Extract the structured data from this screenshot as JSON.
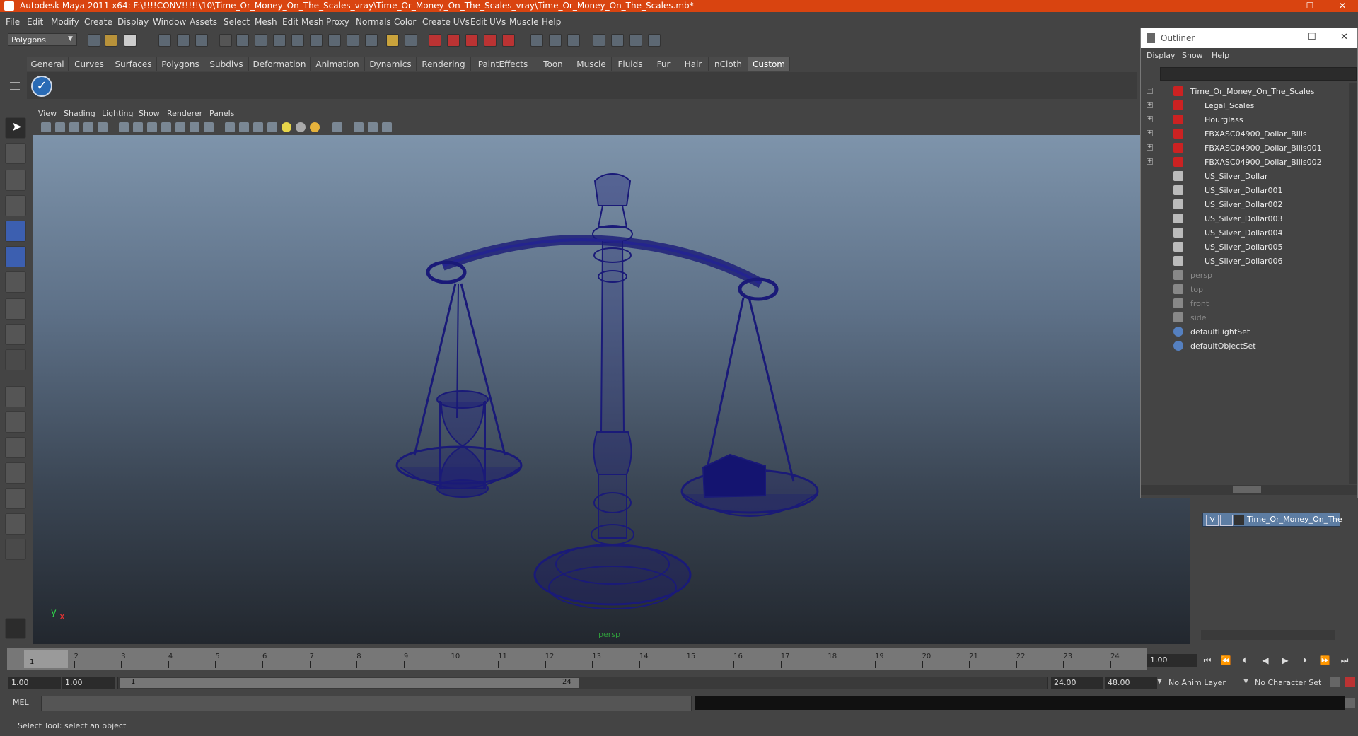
{
  "window": {
    "title": "Autodesk Maya 2011 x64: F:\\!!!!CONV!!!!!\\10\\Time_Or_Money_On_The_Scales_vray\\Time_Or_Money_On_The_Scales_vray\\Time_Or_Money_On_The_Scales.mb*",
    "minimize": "—",
    "maximize": "☐",
    "close": "✕"
  },
  "menubar": [
    "File",
    "Edit",
    "Modify",
    "Create",
    "Display",
    "Window",
    "Assets",
    "Select",
    "Mesh",
    "Edit Mesh",
    "Proxy",
    "Normals",
    "Color",
    "Create UVs",
    "Edit UVs",
    "Muscle",
    "Help"
  ],
  "statusline": {
    "mode": "Polygons"
  },
  "shelf": {
    "tabs": [
      "General",
      "Curves",
      "Surfaces",
      "Polygons",
      "Subdivs",
      "Deformation",
      "Animation",
      "Dynamics",
      "Rendering",
      "PaintEffects",
      "Toon",
      "Muscle",
      "Fluids",
      "Fur",
      "Hair",
      "nCloth",
      "Custom"
    ],
    "active_tab": "Custom"
  },
  "viewport": {
    "menu": [
      "View",
      "Shading",
      "Lighting",
      "Show",
      "Renderer",
      "Panels"
    ],
    "camera_label": "persp",
    "axis_x": "x",
    "axis_y": "y"
  },
  "outliner": {
    "title": "Outliner",
    "menu": [
      "Display",
      "Show",
      "Help"
    ],
    "items": [
      {
        "label": "Time_Or_Money_On_The_Scales",
        "expand": "−",
        "icon": "transform-icon"
      },
      {
        "label": "Legal_Scales",
        "expand": "+",
        "icon": "transform-icon"
      },
      {
        "label": "Hourglass",
        "expand": "+",
        "icon": "transform-icon"
      },
      {
        "label": "FBXASC04900_Dollar_Bills",
        "expand": "+",
        "icon": "transform-icon"
      },
      {
        "label": "FBXASC04900_Dollar_Bills001",
        "expand": "+",
        "icon": "transform-icon"
      },
      {
        "label": "FBXASC04900_Dollar_Bills002",
        "expand": "+",
        "icon": "transform-icon"
      },
      {
        "label": "US_Silver_Dollar",
        "expand": "",
        "icon": "mesh-icon"
      },
      {
        "label": "US_Silver_Dollar001",
        "expand": "",
        "icon": "mesh-icon"
      },
      {
        "label": "US_Silver_Dollar002",
        "expand": "",
        "icon": "mesh-icon"
      },
      {
        "label": "US_Silver_Dollar003",
        "expand": "",
        "icon": "mesh-icon"
      },
      {
        "label": "US_Silver_Dollar004",
        "expand": "",
        "icon": "mesh-icon"
      },
      {
        "label": "US_Silver_Dollar005",
        "expand": "",
        "icon": "mesh-icon"
      },
      {
        "label": "US_Silver_Dollar006",
        "expand": "",
        "icon": "mesh-icon"
      },
      {
        "label": "persp",
        "expand": "",
        "icon": "camera-icon"
      },
      {
        "label": "top",
        "expand": "",
        "icon": "camera-icon"
      },
      {
        "label": "front",
        "expand": "",
        "icon": "camera-icon"
      },
      {
        "label": "side",
        "expand": "",
        "icon": "camera-icon"
      },
      {
        "label": "defaultLightSet",
        "expand": "",
        "icon": "set-icon"
      },
      {
        "label": "defaultObjectSet",
        "expand": "",
        "icon": "set-icon"
      }
    ]
  },
  "layers": {
    "visible": "V",
    "name": "Time_Or_Money_On_The"
  },
  "timeline": {
    "ticks": [
      "1",
      "2",
      "3",
      "4",
      "5",
      "6",
      "7",
      "8",
      "9",
      "10",
      "11",
      "12",
      "13",
      "14",
      "15",
      "16",
      "17",
      "18",
      "19",
      "20",
      "21",
      "22",
      "23",
      "24"
    ],
    "current_marker": "1",
    "current_frame": "1.00"
  },
  "range": {
    "start": "1.00",
    "anim_start": "1.00",
    "slider_start": "1",
    "slider_end": "24",
    "anim_end": "24.00",
    "end": "48.00",
    "anim_layer": "No Anim Layer",
    "character_set": "No Character Set"
  },
  "command": {
    "label": "MEL"
  },
  "help": {
    "text": "Select Tool: select an object"
  },
  "colors": {
    "titlebar": "#d94410",
    "wireframe": "#1a1a78",
    "active_layer": "#5d7da3"
  }
}
